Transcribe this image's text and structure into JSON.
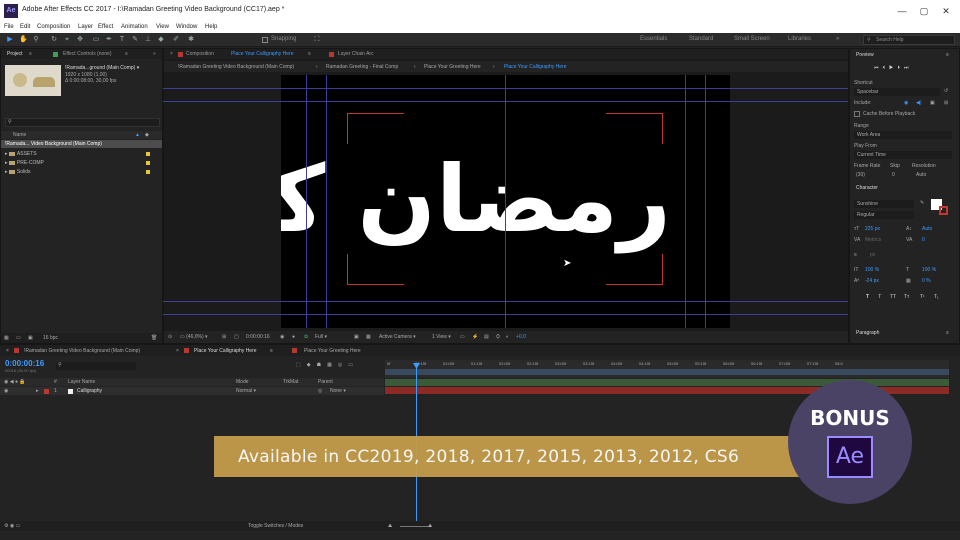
{
  "window": {
    "app_icon": "Ae",
    "title": "Adobe After Effects CC 2017 - I:\\Ramadan Greeting Video Background (CC17).aep *",
    "minimize": "—",
    "maximize": "▢",
    "close": "✕"
  },
  "menu": [
    "File",
    "Edit",
    "Composition",
    "Layer",
    "Effect",
    "Animation",
    "View",
    "Window",
    "Help"
  ],
  "toolbar": {
    "snapping": "Snapping",
    "workspaces": [
      "Essentials",
      "Standard",
      "Small Screen",
      "Libraries"
    ],
    "search_placeholder": "Search Help"
  },
  "project_panel": {
    "tabs": [
      "Project",
      "Effect Controls (none)"
    ],
    "selected_name": "!Ramada...ground (Main Comp) ▾",
    "selected_info1": "1920 x 1080 (1,00)",
    "selected_info2": "Δ 0:00:08:00, 30,00 fps",
    "search_placeholder": "",
    "column_name": "Name",
    "items": [
      {
        "name": "!Ramada... Video Background (Main Comp)",
        "type": "comp"
      },
      {
        "name": "ASSETS",
        "type": "folder"
      },
      {
        "name": "PRE-COMP",
        "type": "folder"
      },
      {
        "name": "Solids",
        "type": "folder"
      }
    ],
    "bpc": "16 bpc"
  },
  "composition_panel": {
    "tab_label": "Composition",
    "tab_name": "Place Your Calligraphy Here",
    "layer_tab": "Layer  Chain Arc",
    "breadcrumbs": [
      "!Ramadan Greeting Video Background (Main Comp)",
      "Ramadan Greeting - Final Comp",
      "Place Your Greeting Here",
      "Place Your Calligraphy Here"
    ],
    "calligraphy_text": "رمضان كريم",
    "footer": {
      "zoom": "(46,0%)",
      "timecode": "0:00:00:16",
      "resolution": "Full",
      "camera": "Active Camera",
      "views": "1 View",
      "exposure": "+0,0"
    }
  },
  "right_panel": {
    "preview_title": "Preview",
    "shortcut_label": "Shortcut",
    "shortcut_value": "Spacebar",
    "include_label": "Include:",
    "cache_label": "Cache Before Playback",
    "range_label": "Range",
    "range_value": "Work Area",
    "play_from_label": "Play From",
    "play_from_value": "Current Time",
    "frame_rate_label": "Frame Rate",
    "skip_label": "Skip",
    "resolution_label": "Resolution",
    "frame_rate_value": "(30)",
    "skip_value": "0",
    "resolution_value": "Auto",
    "character_title": "Character",
    "font_name": "Sunshine",
    "font_style": "Regular",
    "font_size": "225 px",
    "leading": "Auto",
    "tracking_value": "0",
    "kerning": "Metrics",
    "stroke_unit": "px",
    "vert_scale": "100 %",
    "horiz_scale": "100 %",
    "baseline": "-24 px",
    "tsume": "0 %",
    "style_buttons": [
      "T",
      "T",
      "TT",
      "Tт",
      "T¹",
      "T₁"
    ],
    "paragraph_title": "Paragraph"
  },
  "timeline": {
    "tabs": [
      "!Ramadan Greeting Video Background (Main Comp)",
      "Place Your Calligraphy Here",
      "Place Your Greeting Here"
    ],
    "timecode": "0:00:00:16",
    "frame_info": "00016 (30.00 fps)",
    "columns": [
      "#",
      "Layer Name",
      "Mode",
      "TrkMat",
      "Parent"
    ],
    "layer": {
      "index": "1",
      "name": "Calligraphy",
      "mode": "Normal",
      "parent": "None"
    },
    "ruler": [
      "0f",
      "00:15f",
      "01:00f",
      "01:15f",
      "02:00f",
      "02:15f",
      "03:00f",
      "03:15f",
      "04:00f",
      "04:15f",
      "05:00f",
      "05:15f",
      "06:00f",
      "06:15f",
      "07:00f",
      "07:15f",
      "08:0"
    ],
    "toggle_label": "Toggle Switches / Modes"
  },
  "promo": {
    "banner_text": "Available in CC2019, 2018, 2017, 2015, 2013, 2012, CS6",
    "bonus_text": "BONUS",
    "logo_text": "Ae",
    "colors": {
      "banner": "#c39b4a",
      "circle": "#4b4366",
      "ae_purple": "#9a8cff"
    }
  },
  "colors": {
    "accent_blue": "#2d8ceb",
    "guides": "#3d3c9a",
    "label_red": "#b9372e",
    "label_yellow": "#e0c93c"
  }
}
